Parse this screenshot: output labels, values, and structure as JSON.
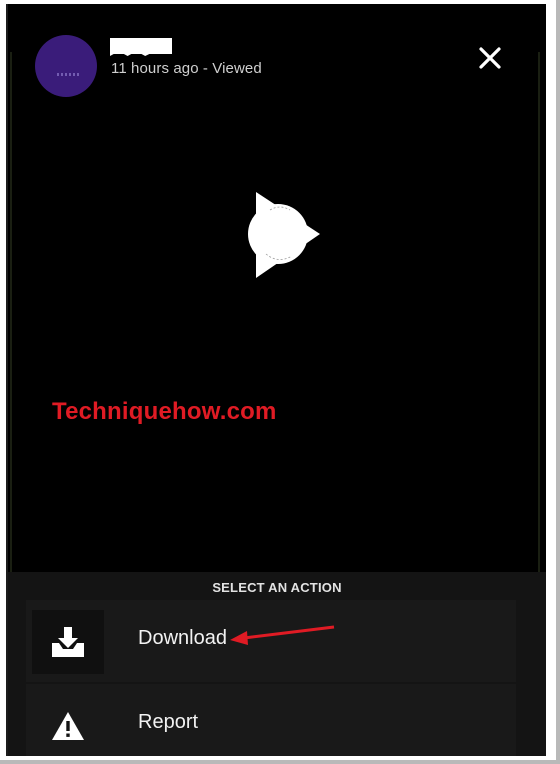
{
  "story": {
    "meta": "11 hours ago - Viewed"
  },
  "watermark": "Techniquehow.com",
  "action_sheet": {
    "title": "SELECT AN ACTION",
    "actions": [
      {
        "label": "Download",
        "icon": "download-tray-icon"
      },
      {
        "label": "Report",
        "icon": "warning-triangle-icon"
      }
    ]
  },
  "colors": {
    "screen_bg": "#000000",
    "sheet_bg": "#141414",
    "avatar": "#3a1c7a",
    "watermark": "#e01b24",
    "annotation_arrow": "#e01b24"
  }
}
